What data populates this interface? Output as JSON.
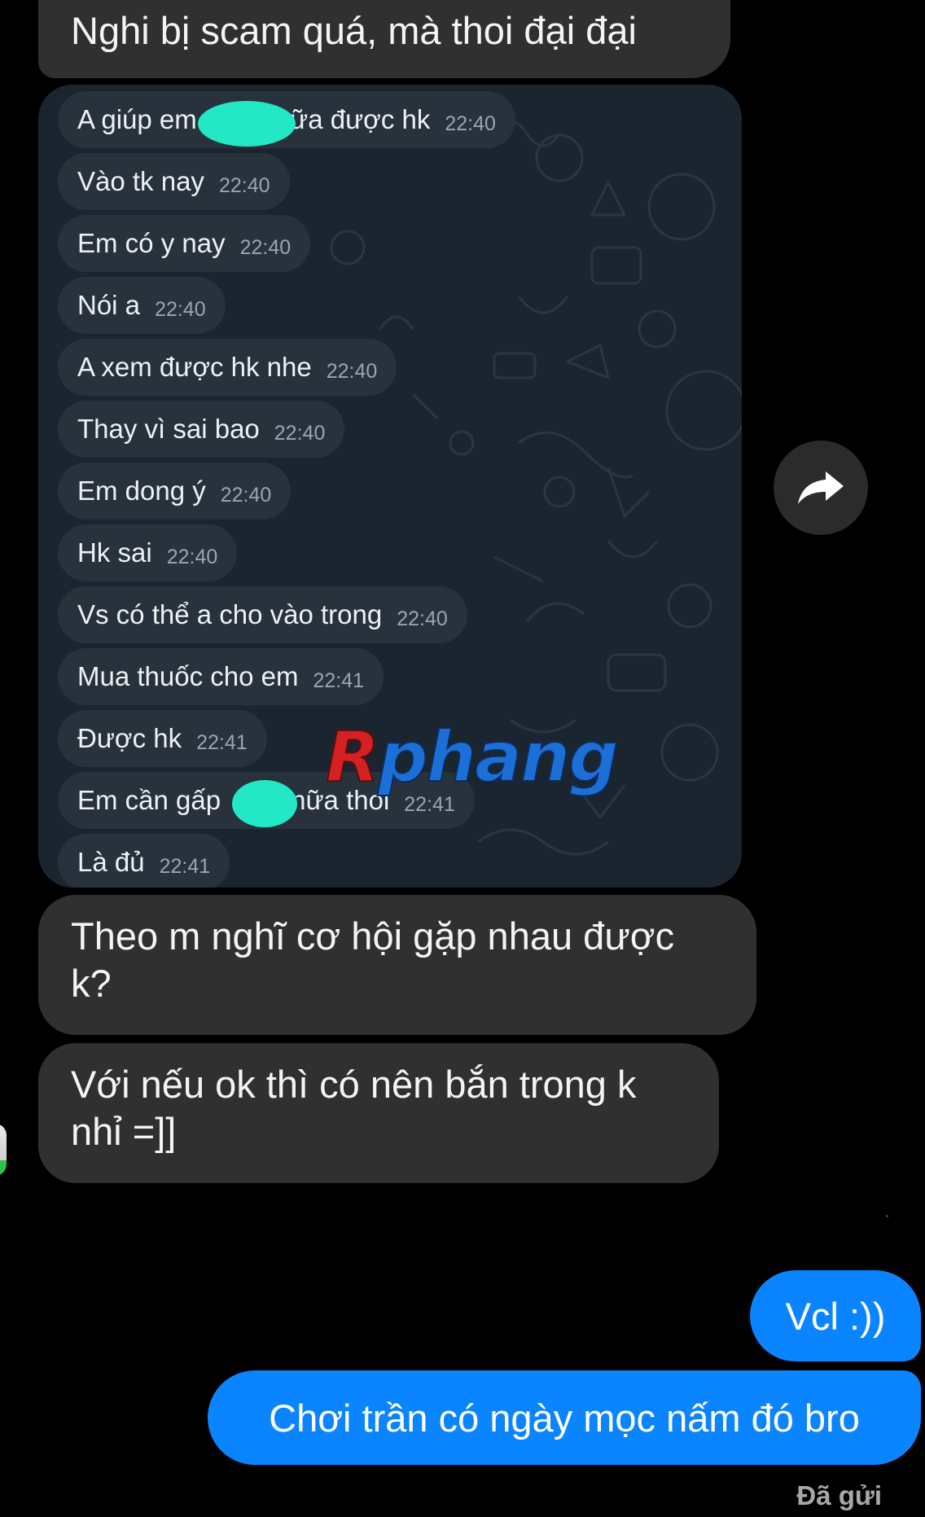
{
  "incoming_messages": {
    "top": "Nghi bị scam quá, mà thoi đại đại",
    "msg1": "Theo m nghĩ cơ hội gặp nhau được k?",
    "msg2": "Với nếu ok thì có nên bắn trong k nhỉ =]]"
  },
  "quoted_chat": {
    "messages": [
      {
        "text_before": "A giúp em",
        "text_after": "nữa được hk",
        "time": "22:40"
      },
      {
        "text": "Vào tk nay",
        "time": "22:40"
      },
      {
        "text": "Em có y nay",
        "time": "22:40"
      },
      {
        "text": "Nói a",
        "time": "22:40"
      },
      {
        "text": "A xem được hk nhe",
        "time": "22:40"
      },
      {
        "text": "Thay vì sai bao",
        "time": "22:40"
      },
      {
        "text": "Em dong ý",
        "time": "22:40"
      },
      {
        "text": "Hk sai",
        "time": "22:40"
      },
      {
        "text": "Vs có thể a cho vào trong",
        "time": "22:40"
      },
      {
        "text": "Mua thuốc cho em",
        "time": "22:41"
      },
      {
        "text": "Được hk",
        "time": "22:41"
      },
      {
        "text_before": "Em cần gấp",
        "text_after": "nữa thoi",
        "time": "22:41"
      },
      {
        "text": "Là đủ",
        "time": "22:41"
      }
    ],
    "background_color": "#1b2530",
    "bubble_color": "#27323d",
    "redaction_color": "#22e8c6"
  },
  "watermark": {
    "first_letter": "R",
    "rest": "phang"
  },
  "share_button": {
    "icon": "share-arrow-icon"
  },
  "sent_messages": {
    "msg1": "Vcl :))",
    "msg2": "Chơi trần có ngày mọc nấm đó bro"
  },
  "status": "Đã gửi",
  "colors": {
    "incoming_bubble": "#303030",
    "sent_bubble": "#0a84ff",
    "background": "#000000"
  }
}
